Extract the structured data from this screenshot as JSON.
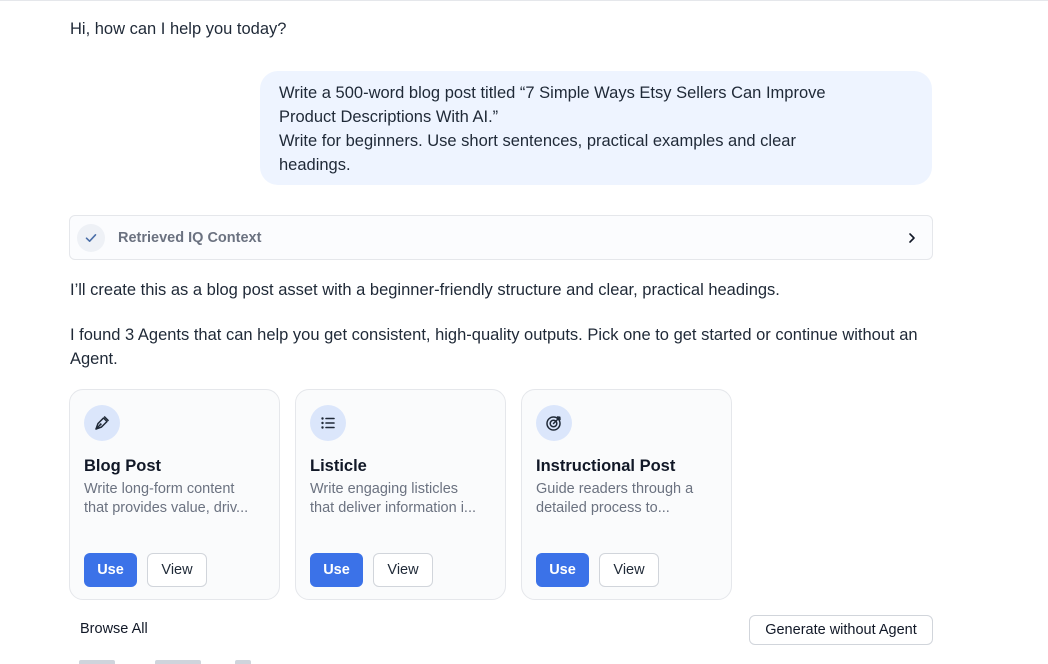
{
  "greeting": "Hi, how can I help you today?",
  "user_message": {
    "lines": [
      "Write a 500-word blog post titled “7 Simple Ways Etsy Sellers Can Improve",
      "Product Descriptions With AI.”",
      "Write for beginners. Use short sentences, practical examples and clear",
      "headings."
    ]
  },
  "context": {
    "label": "Retrieved IQ Context",
    "check_icon": "check-icon",
    "chevron_icon": "chevron-right-icon"
  },
  "assistant": {
    "para1": "I’ll create this as a blog post asset with a beginner-friendly structure and clear, practical headings.",
    "para2": "I found 3 Agents that can help you get consistent, high-quality outputs. Pick one to get started or continue without an Agent."
  },
  "agents": [
    {
      "icon": "pen-nib-icon",
      "title": "Blog Post",
      "desc_lines": [
        "Write long-form content",
        "that provides value, driv..."
      ],
      "use_label": "Use",
      "view_label": "View"
    },
    {
      "icon": "list-icon",
      "title": "Listicle",
      "desc_lines": [
        "Write engaging listicles",
        "that deliver information i..."
      ],
      "use_label": "Use",
      "view_label": "View"
    },
    {
      "icon": "target-icon",
      "title": "Instructional Post",
      "desc_lines": [
        "Guide readers through a",
        "detailed process to..."
      ],
      "use_label": "Use",
      "view_label": "View"
    }
  ],
  "browse_all": "Browse All",
  "generate_without_agent": "Generate without Agent",
  "colors": {
    "accent": "#3b72e8",
    "bubble": "#eef4ff",
    "icon_bg": "#dbe6fb"
  }
}
